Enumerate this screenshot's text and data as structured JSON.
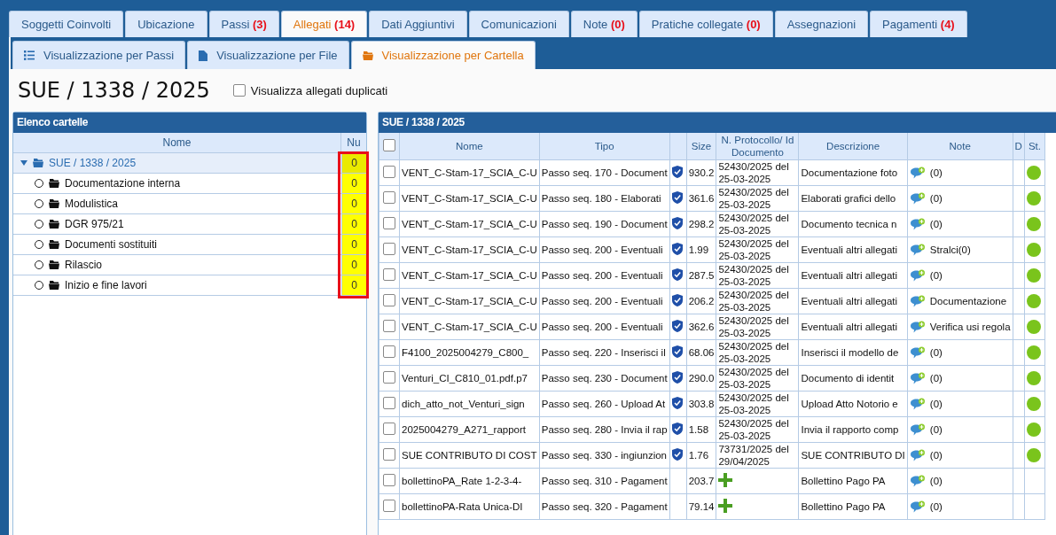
{
  "tabs": [
    {
      "label": "Soggetti Coinvolti",
      "selected": false
    },
    {
      "label": "Ubicazione",
      "selected": false
    },
    {
      "label": "Passi",
      "count": "(3)",
      "selected": false
    },
    {
      "label": "Allegati",
      "count": "(14)",
      "selected": true
    },
    {
      "label": "Dati Aggiuntivi",
      "selected": false
    },
    {
      "label": "Comunicazioni",
      "selected": false
    },
    {
      "label": "Note",
      "count": "(0)",
      "selected": false
    },
    {
      "label": "Pratiche collegate",
      "count": "(0)",
      "selected": false
    },
    {
      "label": "Assegnazioni",
      "selected": false
    },
    {
      "label": "Pagamenti",
      "count": "(4)",
      "selected": false
    }
  ],
  "view_tabs": [
    {
      "label": "Visualizzazione per Passi",
      "kind": "list",
      "selected": false
    },
    {
      "label": "Visualizzazione per File",
      "kind": "file",
      "selected": false
    },
    {
      "label": "Visualizzazione per Cartella",
      "kind": "folder",
      "selected": true
    }
  ],
  "page_title": "SUE / 1338 / 2025",
  "duplicates_checkbox": {
    "label": "Visualizza allegati duplicati",
    "checked": false
  },
  "folder_panel": {
    "title": "Elenco cartelle",
    "columns": [
      "Nome",
      "Nu"
    ],
    "num_column_highlighted": true,
    "tree": [
      {
        "name": "SUE / 1338 / 2025",
        "count": "0",
        "expanded": true,
        "children": [
          {
            "name": "Documentazione interna",
            "count": "0",
            "selected": false
          },
          {
            "name": "Modulistica",
            "count": "0",
            "selected": false
          },
          {
            "name": "DGR 975/21",
            "count": "0",
            "selected": false
          },
          {
            "name": "Documenti sostituiti",
            "count": "0",
            "selected": false
          },
          {
            "name": "Rilascio",
            "count": "0",
            "selected": false
          },
          {
            "name": "Inizio e fine lavori",
            "count": "0",
            "selected": false
          }
        ]
      }
    ]
  },
  "files_panel": {
    "title": "SUE / 1338 / 2025",
    "select_all_checked": false,
    "columns": [
      "Nome",
      "Tipo",
      "Size",
      "N. Protocollo/ Id Documento",
      "Descrizione",
      "Note",
      "D",
      "St."
    ],
    "rows": [
      {
        "checked": false,
        "name": "VENT_C-Stam-17_SCIA_C-U",
        "type": "Passo seq. 170 - Document",
        "signed": true,
        "size": "930.2",
        "protocol": "52430/2025 del 25-03-2025",
        "description": "Documentazione foto",
        "note": "(0)",
        "active": true
      },
      {
        "checked": false,
        "name": "VENT_C-Stam-17_SCIA_C-U",
        "type": "Passo seq. 180 - Elaborati",
        "signed": true,
        "size": "361.6",
        "protocol": "52430/2025 del 25-03-2025",
        "description": "Elaborati grafici dello",
        "note": "(0)",
        "active": true
      },
      {
        "checked": false,
        "name": "VENT_C-Stam-17_SCIA_C-U",
        "type": "Passo seq. 190 - Document",
        "signed": true,
        "size": "298.2",
        "protocol": "52430/2025 del 25-03-2025",
        "description": "Documento tecnica n",
        "note": "(0)",
        "active": true
      },
      {
        "checked": false,
        "name": "VENT_C-Stam-17_SCIA_C-U",
        "type": "Passo seq. 200 - Eventuali",
        "signed": true,
        "size": "1.99",
        "protocol": "52430/2025 del 25-03-2025",
        "description": "Eventuali altri allegati",
        "note": "Stralci(0)",
        "active": true
      },
      {
        "checked": false,
        "name": "VENT_C-Stam-17_SCIA_C-U",
        "type": "Passo seq. 200 - Eventuali",
        "signed": true,
        "size": "287.5",
        "protocol": "52430/2025 del 25-03-2025",
        "description": "Eventuali altri allegati",
        "note": "(0)",
        "active": true
      },
      {
        "checked": false,
        "name": "VENT_C-Stam-17_SCIA_C-U",
        "type": "Passo seq. 200 - Eventuali",
        "signed": true,
        "size": "206.2",
        "protocol": "52430/2025 del 25-03-2025",
        "description": "Eventuali altri allegati",
        "note": "Documentazione",
        "active": true
      },
      {
        "checked": false,
        "name": "VENT_C-Stam-17_SCIA_C-U",
        "type": "Passo seq. 200 - Eventuali",
        "signed": true,
        "size": "362.6",
        "protocol": "52430/2025 del 25-03-2025",
        "description": "Eventuali altri allegati",
        "note": "Verifica usi regola",
        "active": true
      },
      {
        "checked": false,
        "name": "F4100_2025004279_C800_",
        "type": "Passo seq. 220 - Inserisci il",
        "signed": true,
        "size": "68.06",
        "protocol": "52430/2025 del 25-03-2025",
        "description": "Inserisci il modello de",
        "note": "(0)",
        "active": true
      },
      {
        "checked": false,
        "name": "Venturi_CI_C810_01.pdf.p7",
        "type": "Passo seq. 230 - Document",
        "signed": true,
        "size": "290.0",
        "protocol": "52430/2025 del 25-03-2025",
        "description": "Documento di identit",
        "note": "(0)",
        "active": true
      },
      {
        "checked": false,
        "name": "dich_atto_not_Venturi_sign",
        "type": "Passo seq. 260 - Upload At",
        "signed": true,
        "size": "303.8",
        "protocol": "52430/2025 del 25-03-2025",
        "description": "Upload Atto Notorio e",
        "note": "(0)",
        "active": true
      },
      {
        "checked": false,
        "name": "2025004279_A271_rapport",
        "type": "Passo seq. 280 - Invia il rap",
        "signed": true,
        "size": "1.58",
        "protocol": "52430/2025 del 25-03-2025",
        "description": "Invia il rapporto comp",
        "note": "(0)",
        "active": true
      },
      {
        "checked": false,
        "name": "SUE CONTRIBUTO DI COST",
        "type": "Passo seq. 330 - ingiunzion",
        "signed": true,
        "size": "1.76",
        "protocol": "73731/2025 del 29/04/2025",
        "description": "SUE CONTRIBUTO DI",
        "note": "(0)",
        "active": true
      },
      {
        "checked": false,
        "name": "bollettinoPA_Rate 1-2-3-4-",
        "type": "Passo seq. 310 - Pagament",
        "signed": false,
        "size": "203.7",
        "description": "Bollettino Pago PA",
        "note": "(0)",
        "active": false
      },
      {
        "checked": false,
        "name": "bollettinoPA-Rata Unica-DI",
        "type": "Passo seq. 320 - Pagament",
        "signed": false,
        "size": "79.14",
        "description": "Bollettino Pago PA",
        "note": "(0)",
        "active": false
      }
    ]
  }
}
